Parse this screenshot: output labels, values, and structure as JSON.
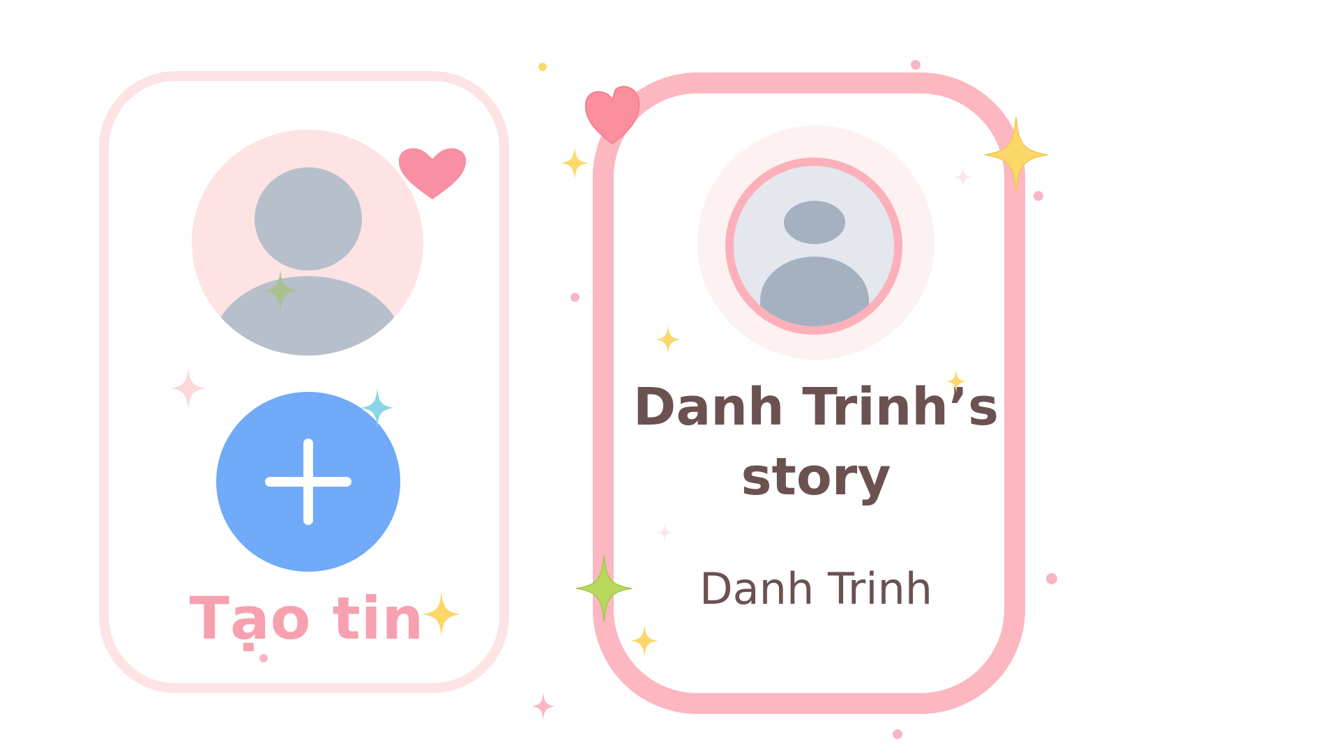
{
  "create_story": {
    "label": "Tạo tin",
    "add_icon": "plus-icon"
  },
  "story": {
    "title": "Danh Trinh’s story",
    "author": "Danh Trinh"
  },
  "colors": {
    "create_card_border": "#fde3e4",
    "create_label": "#f7a0b0",
    "add_button": "#70aaf8",
    "story_card_border": "#fcb7c0",
    "story_text": "#6b5150",
    "avatar_placeholder": "#b7bfcb",
    "heart": "#f98fa2",
    "sparkle_yellow": "#fcd86a",
    "sparkle_green": "#b6d85c",
    "sparkle_blue": "#8ad6e8",
    "sparkle_pink": "#fcd7dc"
  },
  "decorations": {
    "hearts": [
      "heart-icon",
      "heart-icon"
    ],
    "sparkles": [
      "sparkle-icon"
    ]
  }
}
